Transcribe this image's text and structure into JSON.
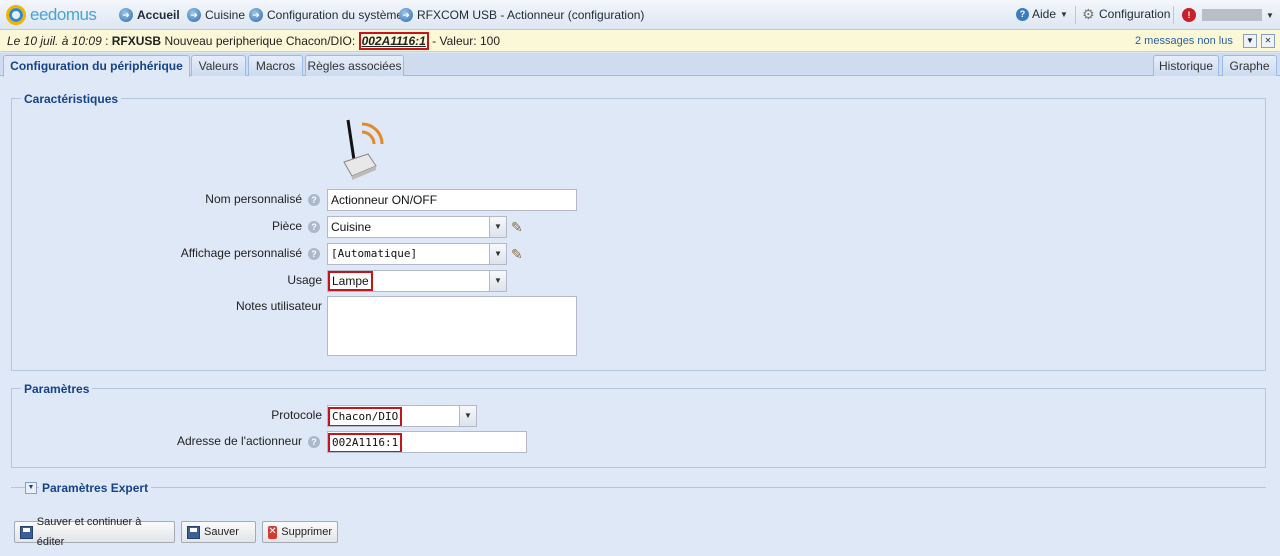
{
  "topbar": {
    "logo": "eedomus",
    "nav": [
      {
        "label": "Accueil"
      },
      {
        "label": "Cuisine"
      },
      {
        "label": "Configuration du système"
      },
      {
        "label": "RFXCOM USB - Actionneur (configuration)"
      }
    ],
    "help_label": "Aide",
    "config_label": "Configuration"
  },
  "notification": {
    "date": "Le 10 juil. à 10:09",
    "separator": " : ",
    "source": "RFXUSB",
    "message": " Nouveau peripherique Chacon/DIO: ",
    "code": "002A1116:1",
    "value": " - Valeur: 100",
    "unread": "2 messages non lus"
  },
  "tabs": {
    "left": [
      "Configuration du périphérique",
      "Valeurs",
      "Macros",
      "Règles associées"
    ],
    "right": [
      "Historique",
      "Graphe"
    ]
  },
  "caracteristiques": {
    "legend": "Caractéristiques",
    "nom_label": "Nom personnalisé",
    "nom_value": "Actionneur ON/OFF",
    "piece_label": "Pièce",
    "piece_value": "Cuisine",
    "affichage_label": "Affichage personnalisé",
    "affichage_value": "[Automatique]",
    "usage_label": "Usage",
    "usage_value": "Lampe",
    "notes_label": "Notes utilisateur",
    "notes_value": ""
  },
  "parametres": {
    "legend": "Paramètres",
    "protocole_label": "Protocole",
    "protocole_value": "Chacon/DIO",
    "adresse_label": "Adresse de l'actionneur",
    "adresse_value": "002A1116:1"
  },
  "expert": {
    "legend": "Paramètres Expert"
  },
  "buttons": {
    "save_continue": "Sauver et continuer à éditer",
    "save": "Sauver",
    "delete": "Supprimer"
  },
  "colors": {
    "highlight": "#c4141c",
    "legend": "#15428b",
    "background": "#dfe8f6"
  }
}
